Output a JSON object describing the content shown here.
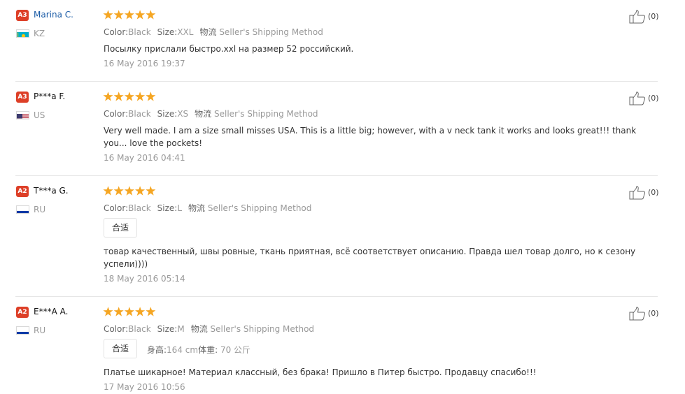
{
  "labels": {
    "color": "Color:",
    "size": "Size:",
    "logistics": "物流"
  },
  "reviews": [
    {
      "level": "A3",
      "name": "Marina C.",
      "name_is_link": true,
      "country": "KZ",
      "flag": "kz",
      "rating": 5,
      "color": "Black",
      "size": "XXL",
      "shipping": "Seller's Shipping Method",
      "tag": "",
      "height_label": "",
      "height": "",
      "weight_label": "",
      "weight": "",
      "text": "Посылку прислали быстро.xxl на размер 52 российский.",
      "date": "16 May 2016 19:37",
      "helpful_count": "(0)"
    },
    {
      "level": "A3",
      "name": "P***a F.",
      "name_is_link": false,
      "country": "US",
      "flag": "us",
      "rating": 5,
      "color": "Black",
      "size": "XS",
      "shipping": "Seller's Shipping Method",
      "tag": "",
      "height_label": "",
      "height": "",
      "weight_label": "",
      "weight": "",
      "text": "Very well made. I am a size small misses USA. This is a little big; however, with a v neck tank it works and looks great!!! thank you... love the pockets!",
      "date": "16 May 2016 04:41",
      "helpful_count": "(0)"
    },
    {
      "level": "A2",
      "name": "T***a G.",
      "name_is_link": false,
      "country": "RU",
      "flag": "ru",
      "rating": 5,
      "color": "Black",
      "size": "L",
      "shipping": "Seller's Shipping Method",
      "tag": "合适",
      "height_label": "",
      "height": "",
      "weight_label": "",
      "weight": "",
      "text": "товар качественный, швы ровные, ткань приятная, всё соответствует описанию. Правда шел товар долго, но к сезону успели))))",
      "date": "18 May 2016 05:14",
      "helpful_count": "(0)"
    },
    {
      "level": "A2",
      "name": "E***A A.",
      "name_is_link": false,
      "country": "RU",
      "flag": "ru",
      "rating": 5,
      "color": "Black",
      "size": "M",
      "shipping": "Seller's Shipping Method",
      "tag": "合适",
      "height_label": "身高:",
      "height": "164 cm",
      "weight_label": "体重:",
      "weight": "70 公斤",
      "text": "Платье шикарное! Материал классный, без брака! Пришло в Питер быстро. Продавцу спасибо!!!",
      "date": "17 May 2016 10:56",
      "helpful_count": "(0)"
    }
  ],
  "colors": {
    "badge": "#dd3f27",
    "star": "#f5a623",
    "link": "#1a5ba6",
    "divider": "#e6e6e6",
    "muted": "#999999"
  },
  "icons": {
    "rating": "star-icon",
    "helpful": "thumbs-up-icon",
    "country": "flag-icon"
  }
}
